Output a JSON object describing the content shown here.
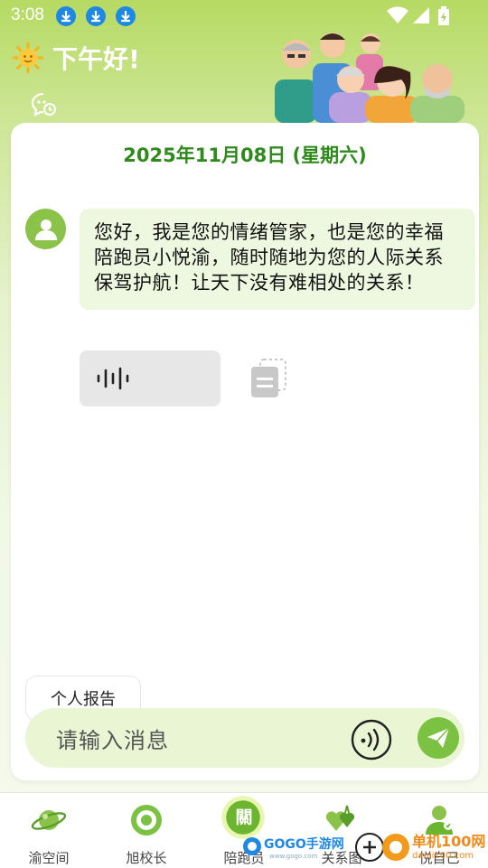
{
  "status_bar": {
    "time": "3:08"
  },
  "header": {
    "greeting": "下午好!"
  },
  "chat": {
    "date": "2025年11月08日 (星期六)",
    "message": "您好，我是您的情绪管家，也是您的幸福陪跑员小悦渝，随时随地为您的人际关系保驾护航！让天下没有难相处的关系！"
  },
  "report_button": {
    "label": "个人报告"
  },
  "input": {
    "placeholder": "请输入消息"
  },
  "tabs": [
    {
      "label": "渝空间",
      "icon": "planet-icon"
    },
    {
      "label": "旭校长",
      "icon": "target-icon"
    },
    {
      "label": "陪跑员",
      "icon": "chat-badge-icon",
      "badge": "關"
    },
    {
      "label": "关系图",
      "icon": "hearts-icon"
    },
    {
      "label": "悦自己",
      "icon": "person-icon"
    }
  ],
  "watermarks": {
    "left": "GOGO手游网",
    "left_small": "www.gogo.com",
    "right": "单机100网",
    "right_small": "danji100.com"
  },
  "colors": {
    "accent": "#7cc242",
    "date_green": "#2f8a1d",
    "bubble": "#eef7df"
  }
}
